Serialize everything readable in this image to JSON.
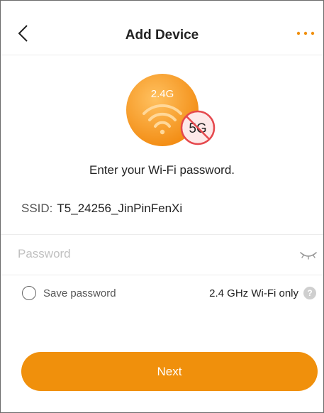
{
  "header": {
    "title": "Add Device",
    "back_icon": "chevron-left-icon",
    "more_icon": "more-horizontal-icon"
  },
  "illustration": {
    "band_24": "2.4G",
    "band_5": "5G",
    "wifi_icon": "wifi-icon",
    "no_5g_icon": "prohibited-icon"
  },
  "prompt": "Enter your Wi-Fi password.",
  "ssid": {
    "label": "SSID:",
    "value": "T5_24256_JinPinFenXi"
  },
  "password": {
    "placeholder": "Password",
    "value": "",
    "toggle_icon": "eye-closed-icon"
  },
  "save_password": {
    "label": "Save password",
    "checked": false
  },
  "wifi_only": {
    "label": "2.4 GHz Wi-Fi only",
    "help_icon": "help-icon",
    "help_glyph": "?"
  },
  "next_button": "Next",
  "colors": {
    "accent": "#f0900c",
    "orb_light": "#ffc160",
    "orb_dark": "#f28a10",
    "no_5g_red": "#e5484d"
  }
}
